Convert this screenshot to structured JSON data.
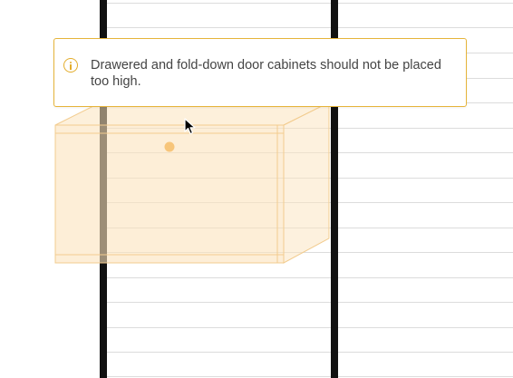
{
  "tooltip": {
    "icon": "info-icon",
    "message": "Drawered and fold-down door cabinets should not be placed too high.",
    "border_color": "#e6b43a",
    "icon_color": "#e3ad2c"
  },
  "cabinet": {
    "fill_color": "#fce3bd",
    "stroke_color": "#f2cc8f"
  },
  "wall": {
    "rail_color": "#111111",
    "shelf_line_color": "#dcdcdc"
  },
  "cursor": {
    "icon": "mouse-pointer-icon"
  }
}
